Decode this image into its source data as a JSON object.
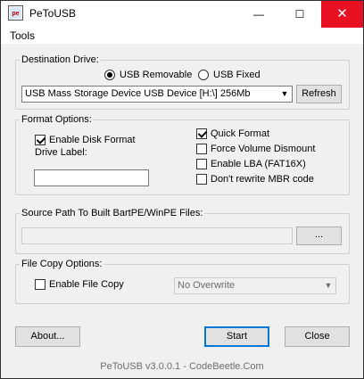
{
  "window": {
    "title": "PeToUSB",
    "icon_label": "pe",
    "minimize_glyph": "—",
    "maximize_glyph": "☐",
    "close_glyph": "✕",
    "close_color": "#e81123"
  },
  "menu": {
    "items": [
      "Tools"
    ]
  },
  "destination": {
    "label": "Destination Drive:",
    "usb_removable": {
      "label": "USB Removable",
      "selected": true
    },
    "usb_fixed": {
      "label": "USB Fixed",
      "selected": false
    },
    "drive_select": {
      "value": "USB Mass  Storage Device USB Device [H:\\] 256Mb"
    },
    "refresh_label": "Refresh"
  },
  "format": {
    "label": "Format Options:",
    "enable_disk_format": {
      "label": "Enable Disk Format",
      "checked": true
    },
    "drive_label_label": "Drive Label:",
    "drive_label_value": "",
    "quick_format": {
      "label": "Quick Format",
      "checked": true
    },
    "force_volume_dismount": {
      "label": "Force Volume Dismount",
      "checked": false
    },
    "enable_lba": {
      "label": "Enable LBA (FAT16X)",
      "checked": false
    },
    "dont_rewrite_mbr": {
      "label": "Don't rewrite MBR code",
      "checked": false
    }
  },
  "source": {
    "label": "Source Path To Built BartPE/WinPE Files:",
    "path_value": "",
    "browse_label": "..."
  },
  "file_copy": {
    "label": "File Copy Options:",
    "enable_file_copy": {
      "label": "Enable File Copy",
      "checked": false
    },
    "overwrite_select": {
      "value": "No Overwrite"
    }
  },
  "buttons": {
    "about": "About...",
    "start": "Start",
    "close": "Close"
  },
  "footer": "PeToUSB v3.0.0.1 - CodeBeetle.Com",
  "colors": {
    "accent": "#0078d7",
    "background": "#f0f0f0",
    "group_border": "#d0d0d0"
  }
}
